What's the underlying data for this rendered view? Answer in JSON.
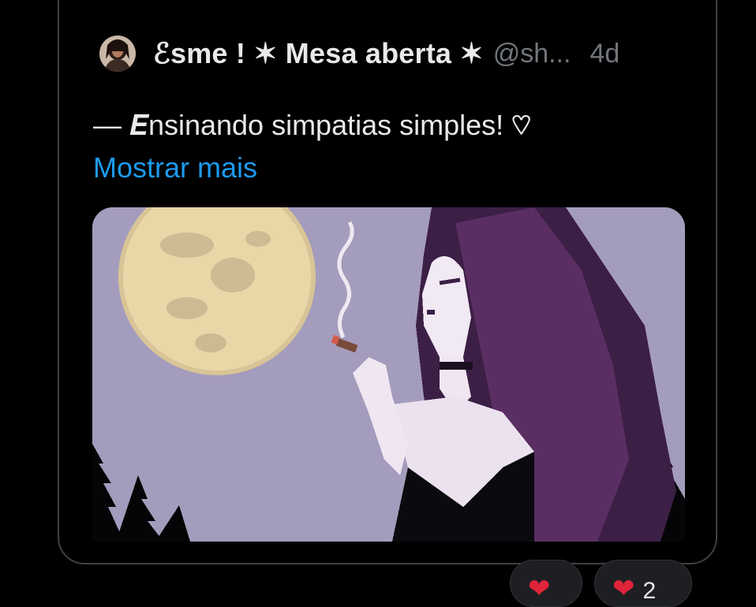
{
  "post": {
    "author_name": "ℰsme ! ✶ Mesa aberta ✶",
    "handle": "@sh...",
    "time": "4d",
    "text": "— 𝑬nsinando simpatias simples! ♡",
    "show_more": "Mostrar mais",
    "avatar_icon": "avatar-image",
    "media_icon": "pixel-art-moon-woman-image"
  },
  "reactions": [
    {
      "icon": "heart-icon",
      "count": ""
    },
    {
      "icon": "heart-icon",
      "count": "2"
    }
  ],
  "colors": {
    "background": "#000000",
    "border": "#3e4144",
    "text": "#e7e9ea",
    "muted": "#71767b",
    "link": "#1d9bf0",
    "heart": "#e0243a",
    "sky": "#a49cbc",
    "moon": "#ead8ac"
  }
}
